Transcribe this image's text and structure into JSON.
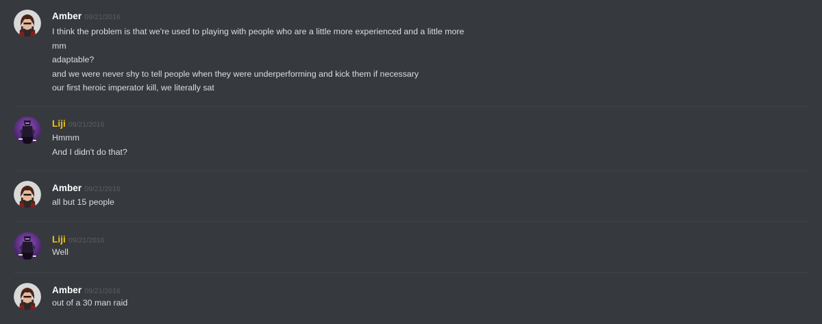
{
  "colors": {
    "background": "#36393e",
    "text": "#dcddde",
    "timestamp": "#5b5e63",
    "divider": "#3f4247",
    "user_amber": "#ffffff",
    "user_liji": "#f1c40f"
  },
  "messages": [
    {
      "author": "Amber",
      "avatar_icon": "amber-avatar-icon",
      "timestamp": "09/21/2016",
      "lines": [
        "I think the problem is that we're used to playing with people who are a little more experienced and a little more",
        "mm",
        "adaptable?",
        "and we were never shy to tell people when they were underperforming and kick them if necessary",
        "our first heroic imperator kill, we literally sat"
      ]
    },
    {
      "author": "Liji",
      "avatar_icon": "liji-avatar-icon",
      "timestamp": "09/21/2016",
      "lines": [
        "Hmmm",
        "And I didn't do that?"
      ]
    },
    {
      "author": "Amber",
      "avatar_icon": "amber-avatar-icon",
      "timestamp": "09/21/2016",
      "lines": [
        "all but 15 people"
      ]
    },
    {
      "author": "Liji",
      "avatar_icon": "liji-avatar-icon",
      "timestamp": "09/21/2016",
      "lines": [
        "Well"
      ]
    },
    {
      "author": "Amber",
      "avatar_icon": "amber-avatar-icon",
      "timestamp": "09/21/2016",
      "lines": [
        "out of a 30 man raid"
      ]
    }
  ]
}
